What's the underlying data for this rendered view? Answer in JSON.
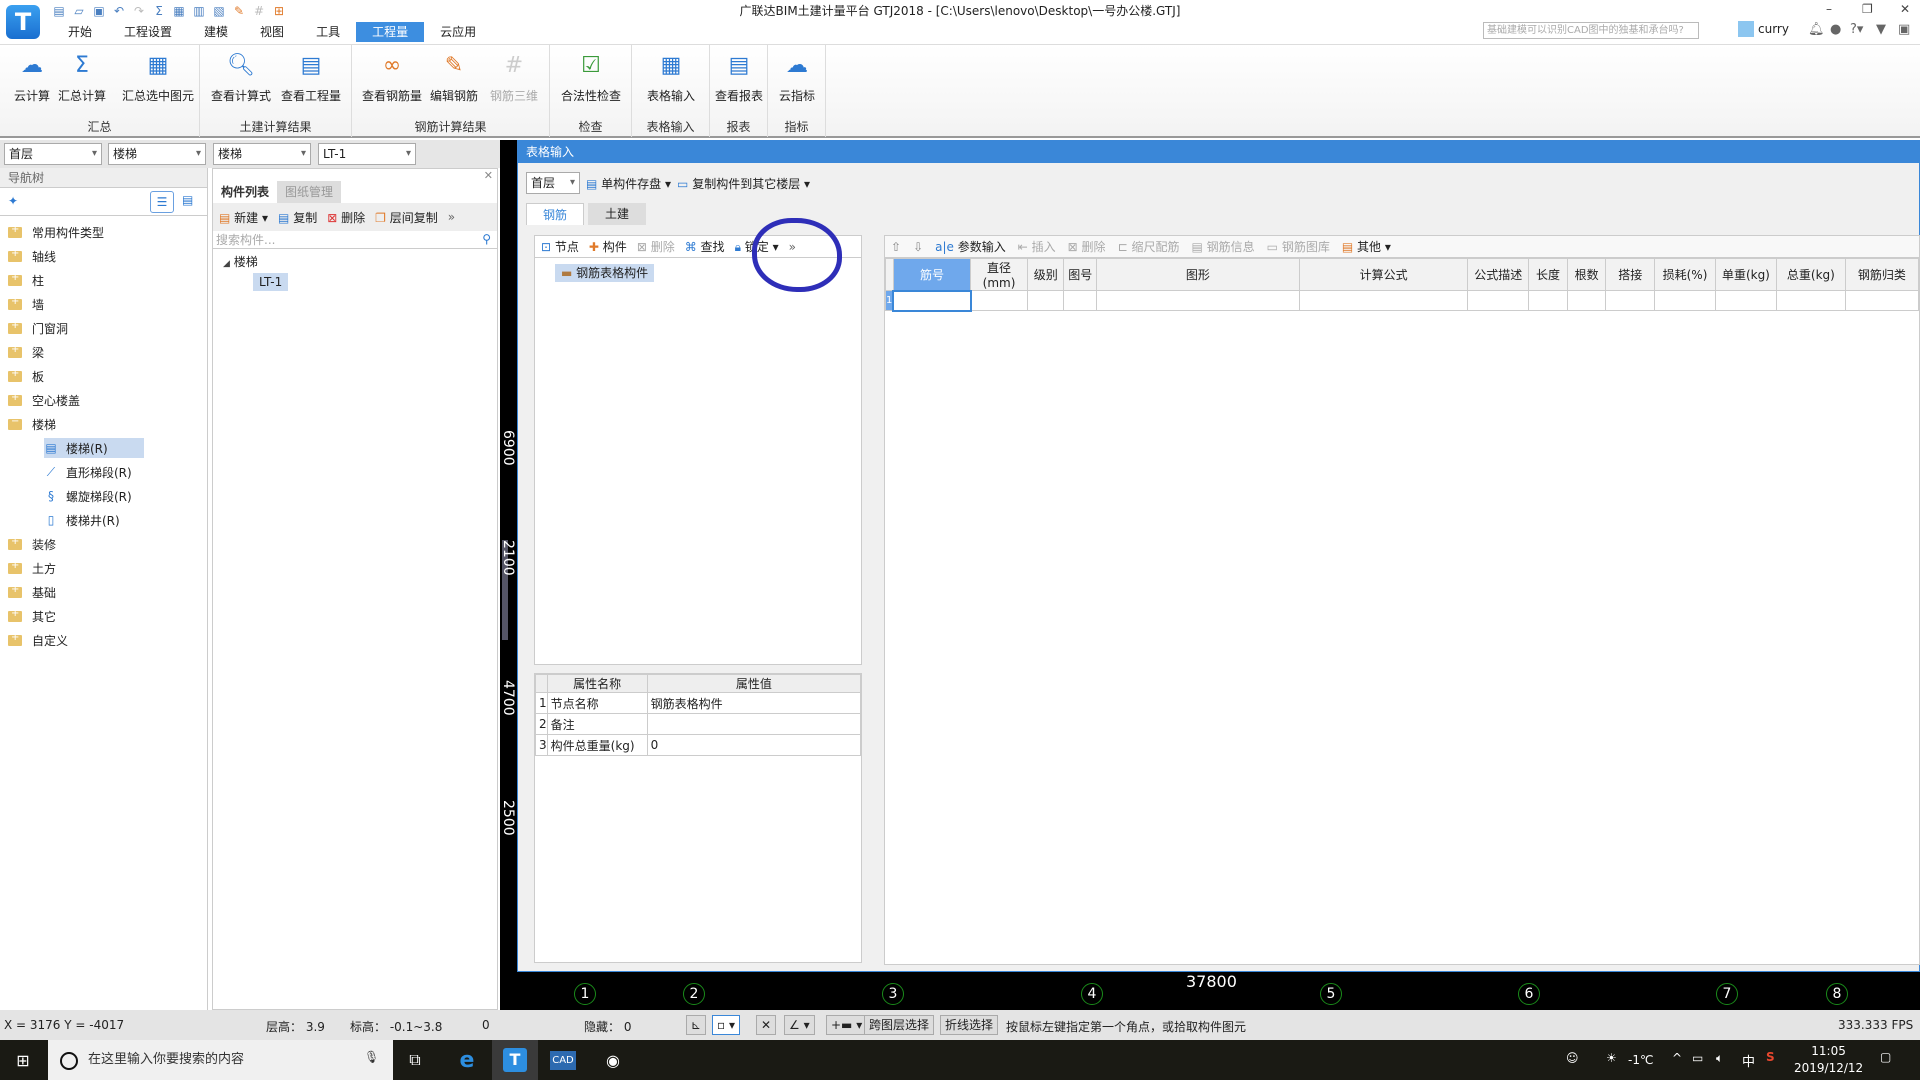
{
  "window": {
    "title": "广联达BIM土建计量平台 GTJ2018 - [C:\\Users\\lenovo\\Desktop\\一号办公楼.GTJ]",
    "search_placeholder": "基础建模可以识别CAD图中的独基和承台吗?",
    "user": "curry",
    "controls": {
      "minimize": "–",
      "restore": "❐",
      "close": "✕"
    }
  },
  "quick_access": [
    "new-file-icon",
    "open-folder-icon",
    "save-icon",
    "undo-icon",
    "redo-icon",
    "sum-icon",
    "calc-icon",
    "view-icon",
    "report-icon",
    "edit-icon",
    "grid-icon",
    "add-icon"
  ],
  "menu_tabs": [
    {
      "label": "开始",
      "active": false
    },
    {
      "label": "工程设置",
      "active": false
    },
    {
      "label": "建模",
      "active": false
    },
    {
      "label": "视图",
      "active": false
    },
    {
      "label": "工具",
      "active": false
    },
    {
      "label": "工程量",
      "active": true
    },
    {
      "label": "云应用",
      "active": false
    }
  ],
  "ribbon": {
    "groups": [
      {
        "label": "汇总",
        "buttons": [
          {
            "label": "云计算",
            "icon": "cloud-sum-icon"
          },
          {
            "label": "汇总计算",
            "icon": "sigma-icon"
          },
          {
            "label": "汇总选中图元",
            "icon": "calculator-icon"
          }
        ]
      },
      {
        "label": "土建计算结果",
        "buttons": [
          {
            "label": "查看计算式",
            "icon": "view-formula-icon"
          },
          {
            "label": "查看工程量",
            "icon": "view-quantity-icon"
          }
        ]
      },
      {
        "label": "钢筋计算结果",
        "buttons": [
          {
            "label": "查看钢筋量",
            "icon": "glasses-icon"
          },
          {
            "label": "编辑钢筋",
            "icon": "pencil-icon"
          },
          {
            "label": "钢筋三维",
            "icon": "rebar-3d-icon",
            "disabled": true
          }
        ]
      },
      {
        "label": "检查",
        "buttons": [
          {
            "label": "合法性检查",
            "icon": "check-icon"
          }
        ]
      },
      {
        "label": "表格输入",
        "buttons": [
          {
            "label": "表格输入",
            "icon": "table-edit-icon"
          }
        ]
      },
      {
        "label": "报表",
        "buttons": [
          {
            "label": "查看报表",
            "icon": "report-search-icon"
          }
        ]
      },
      {
        "label": "指标",
        "buttons": [
          {
            "label": "云指标",
            "icon": "cloud-chart-icon"
          }
        ]
      }
    ]
  },
  "selectors": [
    "首层",
    "楼梯",
    "楼梯",
    "LT-1"
  ],
  "nav": {
    "title": "导航树",
    "items": [
      {
        "label": "常用构件类型"
      },
      {
        "label": "轴线"
      },
      {
        "label": "柱"
      },
      {
        "label": "墙"
      },
      {
        "label": "门窗洞"
      },
      {
        "label": "梁"
      },
      {
        "label": "板"
      },
      {
        "label": "空心楼盖"
      },
      {
        "label": "楼梯",
        "open": true,
        "children": [
          {
            "label": "楼梯(R)",
            "selected": true
          },
          {
            "label": "直形梯段(R)"
          },
          {
            "label": "螺旋梯段(R)"
          },
          {
            "label": "楼梯井(R)"
          }
        ]
      },
      {
        "label": "装修"
      },
      {
        "label": "土方"
      },
      {
        "label": "基础"
      },
      {
        "label": "其它"
      },
      {
        "label": "自定义"
      }
    ]
  },
  "component_list": {
    "tabs": [
      "构件列表",
      "图纸管理"
    ],
    "tools": [
      "新建",
      "复制",
      "删除",
      "层间复制"
    ],
    "search_placeholder": "搜索构件...",
    "tree_root": "楼梯",
    "tree_child": "LT-1"
  },
  "table_input": {
    "title": "表格输入",
    "floor": "首层",
    "save_btn": "单构件存盘",
    "copy_btn": "复制构件到其它楼层",
    "tabs": [
      "钢筋",
      "土建"
    ],
    "tree_tools": {
      "node": "节点",
      "component": "构件",
      "delete": "删除",
      "find": "查找",
      "lock": "锁定"
    },
    "tree_node": "钢筋表格构件",
    "props": {
      "headers": [
        "属性名称",
        "属性值"
      ],
      "rows": [
        {
          "no": "1",
          "name": "节点名称",
          "value": "钢筋表格构件"
        },
        {
          "no": "2",
          "name": "备注",
          "value": ""
        },
        {
          "no": "3",
          "name": "构件总重量(kg)",
          "value": "0"
        }
      ]
    },
    "grid_tools": [
      "参数输入",
      "插入",
      "删除",
      "缩尺配筋",
      "钢筋信息",
      "钢筋图库",
      "其他"
    ],
    "grid_headers": [
      "筋号",
      "直径(mm)",
      "级别",
      "图号",
      "图形",
      "计算公式",
      "公式描述",
      "长度",
      "根数",
      "搭接",
      "损耗(%)",
      "单重(kg)",
      "总重(kg)",
      "钢筋归类"
    ],
    "row_number": "1"
  },
  "cad": {
    "dims_vertical": [
      "6900",
      "2100",
      "4700",
      "2500"
    ],
    "dim_horizontal": "37800",
    "axes": [
      "1",
      "2",
      "3",
      "4",
      "5",
      "6",
      "7",
      "8"
    ]
  },
  "status": {
    "coords": "X = 3176 Y = -4017",
    "floor_height": "层高：  3.9",
    "elevation": "标高：  -0.1~3.8",
    "zero": "0",
    "hidden": "隐藏：  0",
    "cross_layer": "跨图层选择",
    "polyline": "折线选择",
    "hint": "按鼠标左键指定第一个角点，或拾取构件图元",
    "fps": "333.333 FPS"
  },
  "taskbar": {
    "search_placeholder": "在这里输入你要搜索的内容",
    "temp": "-1℃",
    "ime": "中",
    "time": "11:05",
    "date": "2019/12/12"
  }
}
